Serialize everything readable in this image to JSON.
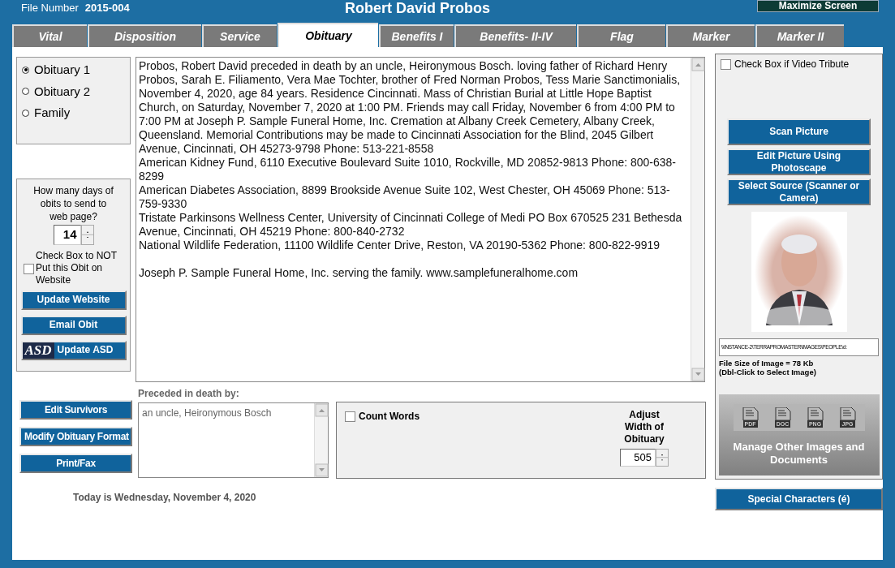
{
  "header": {
    "file_number_label": "File Number",
    "file_number": "2015-004",
    "name": "Robert David Probos",
    "maximize_button": "Maximize Screen"
  },
  "tabs": [
    {
      "label": "Vital",
      "selected": false
    },
    {
      "label": "Disposition",
      "selected": false
    },
    {
      "label": "Service",
      "selected": false
    },
    {
      "label": "Obituary",
      "selected": true
    },
    {
      "label": "Benefits I",
      "selected": false
    },
    {
      "label": "Benefits- II-IV",
      "selected": false
    },
    {
      "label": "Flag",
      "selected": false
    },
    {
      "label": "Marker",
      "selected": false
    },
    {
      "label": "Marker II",
      "selected": false
    }
  ],
  "obituary_options": [
    {
      "label": "Obituary 1",
      "selected": true
    },
    {
      "label": "Obituary 2",
      "selected": false
    },
    {
      "label": "Family",
      "selected": false
    }
  ],
  "web_settings": {
    "question": "How many days of obits to send to web page?",
    "days": "14",
    "not_on_website": {
      "label": "Check Box to NOT Put this Obit on Website",
      "checked": false
    },
    "buttons": [
      {
        "label": "Update Website",
        "kind": "plain"
      },
      {
        "label": "Email Obit",
        "kind": "plain"
      },
      {
        "label": "Update ASD",
        "kind": "logo",
        "logo": "ASD"
      }
    ]
  },
  "obituary_text": {
    "paragraphs": [
      "Probos, Robert David preceded in death by an uncle, Heironymous Bosch. loving  father of  Richard Henry Probos, Sarah E. Filiamento, Vera Mae Tochter, brother of Fred Norman Probos, Tess Marie Sanctimonialis, November 4, 2020, age 84 years. Residence Cincinnati. Mass of Christian Burial at Little Hope Baptist Church, on Saturday, November 7, 2020 at 1:00 PM. Friends may call Friday, November 6 from 4:00 PM to 7:00 PM at Joseph P. Sample Funeral Home, Inc. Cremation at Albany Creek Cemetery, Albany Creek, Queensland. Memorial Contributions may be made to Cincinnati Association for the Blind, 2045 Gilbert Avenue, Cincinnati, OH 45273-9798 Phone: 513-221-8558",
      "American Kidney Fund, 6110 Executive Boulevard Suite 1010, Rockville, MD 20852-9813 Phone: 800-638-8299",
      "American Diabetes Association, 8899 Brookside Avenue Suite 102, West Chester, OH 45069 Phone: 513-759-9330",
      "Tristate Parkinsons Wellness Center, University of Cincinnati College of Medi PO Box 670525 231 Bethesda Avenue, Cincinnati, OH 45219 Phone: 800-840-2732",
      "National Wildlife Federation, 11100 Wildlife Center Drive, Reston, VA 20190-5362 Phone: 800-822-9919"
    ],
    "closing": "Joseph P. Sample Funeral Home, Inc. serving the family. www.samplefuneralhome.com"
  },
  "left_buttons": [
    "Edit Survivors",
    "Modify Obituary Format",
    "Print/Fax"
  ],
  "preceded": {
    "label": "Preceded in death by:",
    "value": "an uncle, Heironymous Bosch"
  },
  "count_words": {
    "label": "Count Words",
    "checked": false
  },
  "width_control": {
    "label": "Adjust Width of Obituary",
    "value": "505"
  },
  "today": "Today is Wednesday, November 4, 2020",
  "right_panel": {
    "video_tribute": {
      "label": "Check Box if Video Tribute",
      "checked": false
    },
    "buttons": [
      "Scan Picture",
      "Edit Picture Using Photoscape",
      "Select Source (Scanner or Camera)"
    ],
    "photo": {
      "kind": "picture"
    },
    "image_path": "\\\\INSTANCE-2\\TERRAPROMASTER\\IMAGES\\PEOPLE\\d:",
    "file_size": "File Size of Image = 78 Kb",
    "file_hint": "(Dbl-Click to Select Image)",
    "documents": {
      "types": [
        "PDF",
        "DOC",
        "PNG",
        "JPG"
      ],
      "label": "Manage Other Images and Documents"
    }
  },
  "special_characters_button": "Special Characters (é)"
}
